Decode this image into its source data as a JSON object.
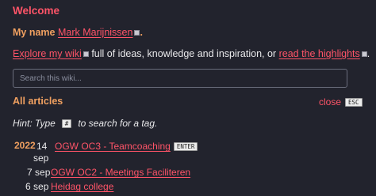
{
  "welcome": {
    "title": "Welcome"
  },
  "intro": {
    "my_name_label": "My name",
    "author_link": "Mark Marijnissen",
    "period": "."
  },
  "explore": {
    "link": "Explore my wiki",
    "text": "full of ideas, knowledge and inspiration, or",
    "highlights_link": "read the highlights",
    "period": "."
  },
  "search": {
    "placeholder": "Search this wiki..."
  },
  "articles": {
    "heading": "All articles",
    "close_label": "close",
    "close_key": "ESC",
    "hint_prefix": "Hint: Type",
    "hint_key": "#",
    "hint_suffix": "to search for a tag.",
    "year": "2022",
    "items": [
      {
        "day": "14",
        "month": "sep",
        "title": "OGW OC3 - Teamcoaching",
        "key": "ENTER"
      },
      {
        "day": "7",
        "month": "sep",
        "title": "OGW OC2 - Meetings Faciliteren"
      },
      {
        "day": "6",
        "month": "sep",
        "title": "Heidag college"
      }
    ]
  },
  "colors": {
    "background": "#22232d",
    "accent_red": "#ff5468",
    "accent_orange": "#f0a060",
    "text": "#e8e8ea"
  }
}
